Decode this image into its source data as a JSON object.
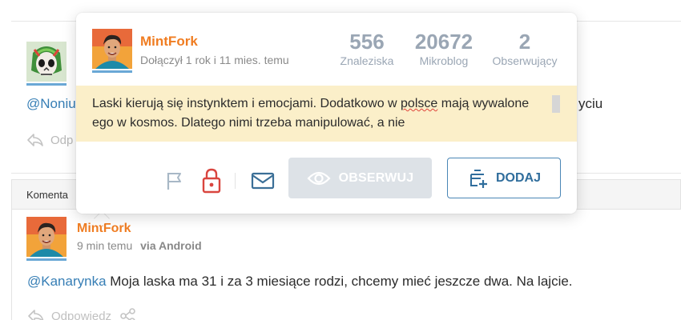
{
  "feed": {
    "entry_text_start": "@Noniu",
    "entry_text_end": "yciu",
    "reply_label": "Odp"
  },
  "comments_bar": {
    "label": "Komenta"
  },
  "popup": {
    "username": "MintFork",
    "joined": "Dołączył 1 rok i 11 mies. temu",
    "stats": [
      {
        "value": "556",
        "label": "Znaleziska"
      },
      {
        "value": "20672",
        "label": "Mikroblog"
      },
      {
        "value": "2",
        "label": "Obserwujący"
      }
    ],
    "bio_part1": "Laski kierują się instynktem i emocjami. Dodatkowo w ",
    "bio_misspelled": "polsce",
    "bio_part2": " mają wywalone ego w kosmos. Dlatego nimi trzeba manipulować, a nie",
    "observe_label": "OBSERWUJ",
    "add_label": "DODAJ"
  },
  "comment": {
    "author": "MintFork",
    "time": "9 min temu",
    "via": "via Android",
    "mention": "@Kanarynka",
    "text": " Moja laska ma 31 i za 3 miesiące rodzi, chcemy mieć jeszcze dwa. Na lajcie.",
    "reply_label": "Odpowiedz"
  },
  "colors": {
    "username": "#f07d22",
    "mention": "#367eb5",
    "bio_bg": "#fbefc9",
    "stat_text": "#9aa6b4",
    "observe_bg": "#dde2e7",
    "add_border": "#4a86b6",
    "lock": "#d9453f"
  }
}
